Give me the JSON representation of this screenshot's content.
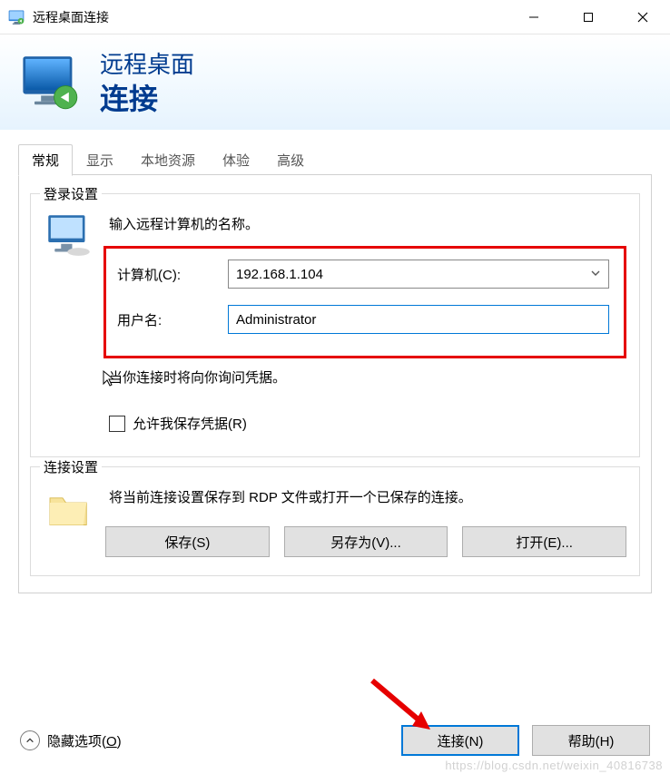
{
  "window": {
    "title": "远程桌面连接",
    "close_label": "Close",
    "minimize_label": "Minimize",
    "maximize_label": "Maximize"
  },
  "banner": {
    "line1": "远程桌面",
    "line2": "连接"
  },
  "tabs": {
    "items": [
      {
        "label": "常规",
        "active": true
      },
      {
        "label": "显示",
        "active": false
      },
      {
        "label": "本地资源",
        "active": false
      },
      {
        "label": "体验",
        "active": false
      },
      {
        "label": "高级",
        "active": false
      }
    ]
  },
  "login_group": {
    "title": "登录设置",
    "prompt": "输入远程计算机的名称。",
    "computer_label": "计算机(C):",
    "computer_value": "192.168.1.104",
    "username_label": "用户名:",
    "username_value": "Administrator",
    "hint": "当你连接时将向你询问凭据。",
    "checkbox_label": "允许我保存凭据(R)"
  },
  "conn_group": {
    "title": "连接设置",
    "desc": "将当前连接设置保存到 RDP 文件或打开一个已保存的连接。",
    "save_label": "保存(S)",
    "save_as_label": "另存为(V)...",
    "open_label": "打开(E)..."
  },
  "footer": {
    "hide_pre": "隐藏选项(",
    "hide_uline": "O",
    "hide_post": ")",
    "connect_label": "连接(N)",
    "help_label": "帮助(H)"
  },
  "watermark": "https://blog.csdn.net/weixin_40816738"
}
